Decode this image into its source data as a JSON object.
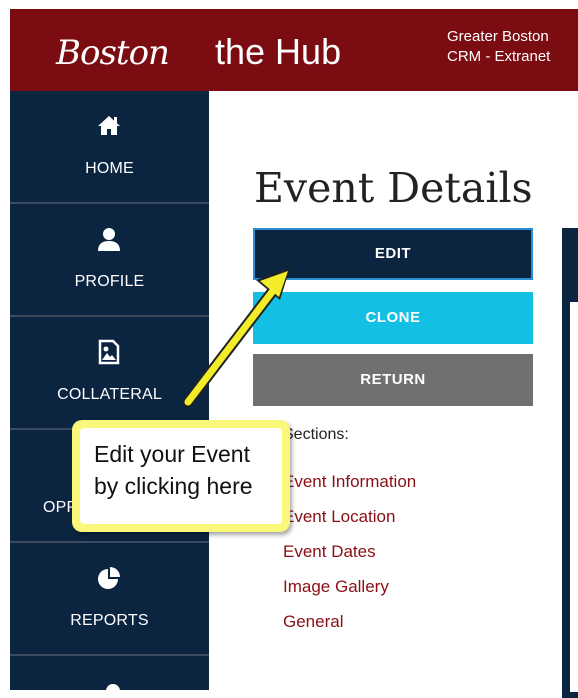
{
  "header": {
    "logo_boston": "Boston",
    "logo_hub": "the Hub",
    "site_title_line1": "Greater Boston",
    "site_title_line2": "CRM - Extranet"
  },
  "sidebar": {
    "items": [
      {
        "label": "HOME",
        "icon": "home-icon"
      },
      {
        "label": "PROFILE",
        "icon": "user-icon"
      },
      {
        "label": "COLLATERAL",
        "icon": "image-icon"
      },
      {
        "label": "OPPORTUNITIES",
        "icon": "opportunities-icon"
      },
      {
        "label": "REPORTS",
        "icon": "pie-chart-icon"
      }
    ]
  },
  "main": {
    "title": "Event Details",
    "buttons": {
      "edit": "EDIT",
      "clone": "CLONE",
      "return": "RETURN"
    },
    "sections_label": "Sections:",
    "sections": [
      "Event Information",
      "Event Location",
      "Event Dates",
      "Image Gallery",
      "General"
    ]
  },
  "callout": {
    "line1": "Edit your Event",
    "line2": "by clicking here"
  },
  "colors": {
    "brand_red": "#7b0c11",
    "sidebar_navy": "#0b2440",
    "clone_cyan": "#13c0e4",
    "return_gray": "#707070",
    "link_red": "#8b0f16",
    "callout_yellow": "#fbf77a"
  }
}
